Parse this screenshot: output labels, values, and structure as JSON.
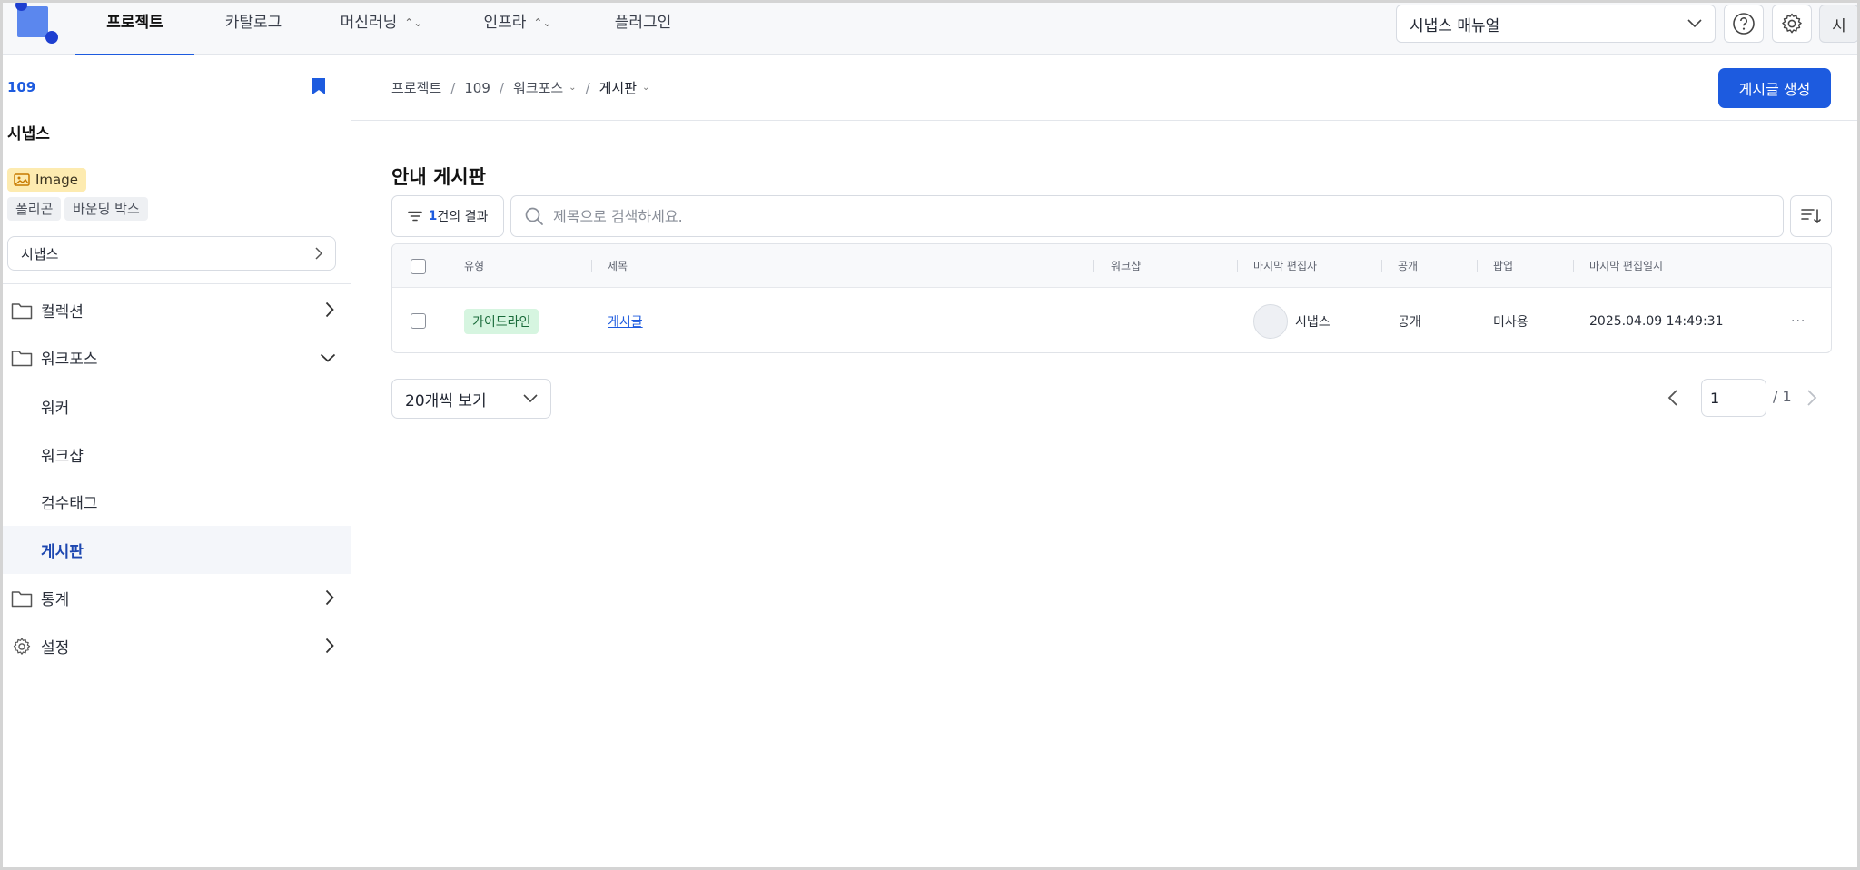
{
  "topnav": {
    "tabs": [
      {
        "label": "프로젝트",
        "active": true
      },
      {
        "label": "카탈로그"
      },
      {
        "label": "머신러닝"
      },
      {
        "label": "인프라"
      },
      {
        "label": "플러그인"
      }
    ],
    "manual_select": "시냅스 매뉴얼",
    "avatar_initial": "시"
  },
  "sidebar": {
    "project_id": "109",
    "project_name": "시냅스",
    "data_type_badge": "Image",
    "tags": [
      "폴리곤",
      "바운딩 박스"
    ],
    "dataset_select": "시냅스",
    "menu": {
      "collection": "컬렉션",
      "workforce": "워크포스",
      "sub": [
        "워커",
        "워크샵",
        "검수태그",
        "게시판"
      ],
      "stats": "통계",
      "settings": "설정"
    }
  },
  "breadcrumb": [
    "프로젝트",
    "109",
    "워크포스",
    "게시판"
  ],
  "actions": {
    "create_post": "게시글 생성"
  },
  "board": {
    "title": "안내 게시판",
    "filter": {
      "count": "1",
      "suffix": "건의 결과"
    },
    "search_placeholder": "제목으로 검색하세요.",
    "columns": [
      "유형",
      "제목",
      "워크샵",
      "마지막 편집자",
      "공개",
      "팝업",
      "마지막 편집일시"
    ],
    "rows": [
      {
        "type": "가이드라인",
        "title": "게시글",
        "workshop": "",
        "editor": "시냅스",
        "visibility": "공개",
        "popup": "미사용",
        "edited_at": "2025.04.09 14:49:31",
        "more": "···"
      }
    ]
  },
  "pagination": {
    "page_size": "20개씩 보기",
    "current": "1",
    "total": "/ 1"
  },
  "colors": {
    "primary": "#1d5bdf",
    "badge_image": "#fdebb0",
    "badge_type": "#d6f5e0"
  }
}
